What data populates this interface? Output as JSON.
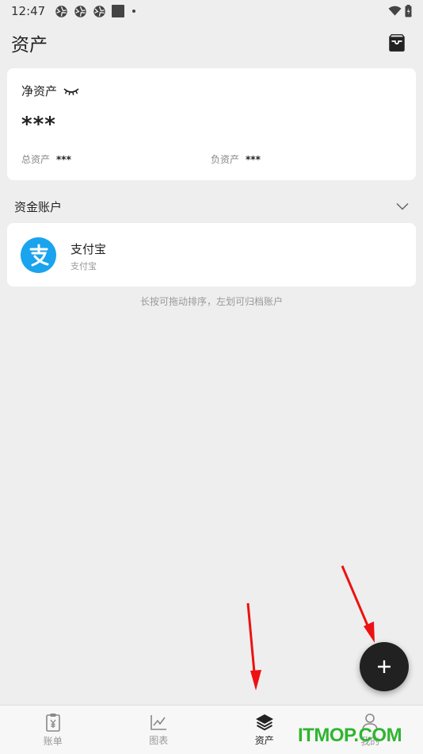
{
  "status_bar": {
    "time": "12:47"
  },
  "app_bar": {
    "title": "资产"
  },
  "net_assets": {
    "label": "净资产",
    "value": "***",
    "total_label": "总资产",
    "total_value": "***",
    "debt_label": "负资产",
    "debt_value": "***"
  },
  "accounts_section": {
    "title": "资金账户"
  },
  "accounts": [
    {
      "name": "支付宝",
      "sub": "支付宝",
      "icon": "alipay-icon",
      "color": "#1aa3ee"
    }
  ],
  "hint": "长按可拖动排序，左划可归档账户",
  "bottom_nav": [
    {
      "label": "账单",
      "icon": "bill-icon"
    },
    {
      "label": "图表",
      "icon": "chart-icon"
    },
    {
      "label": "资产",
      "icon": "layers-icon",
      "active": true
    },
    {
      "label": "我的",
      "icon": "person-icon"
    }
  ],
  "watermark": "ITMOP.COM"
}
